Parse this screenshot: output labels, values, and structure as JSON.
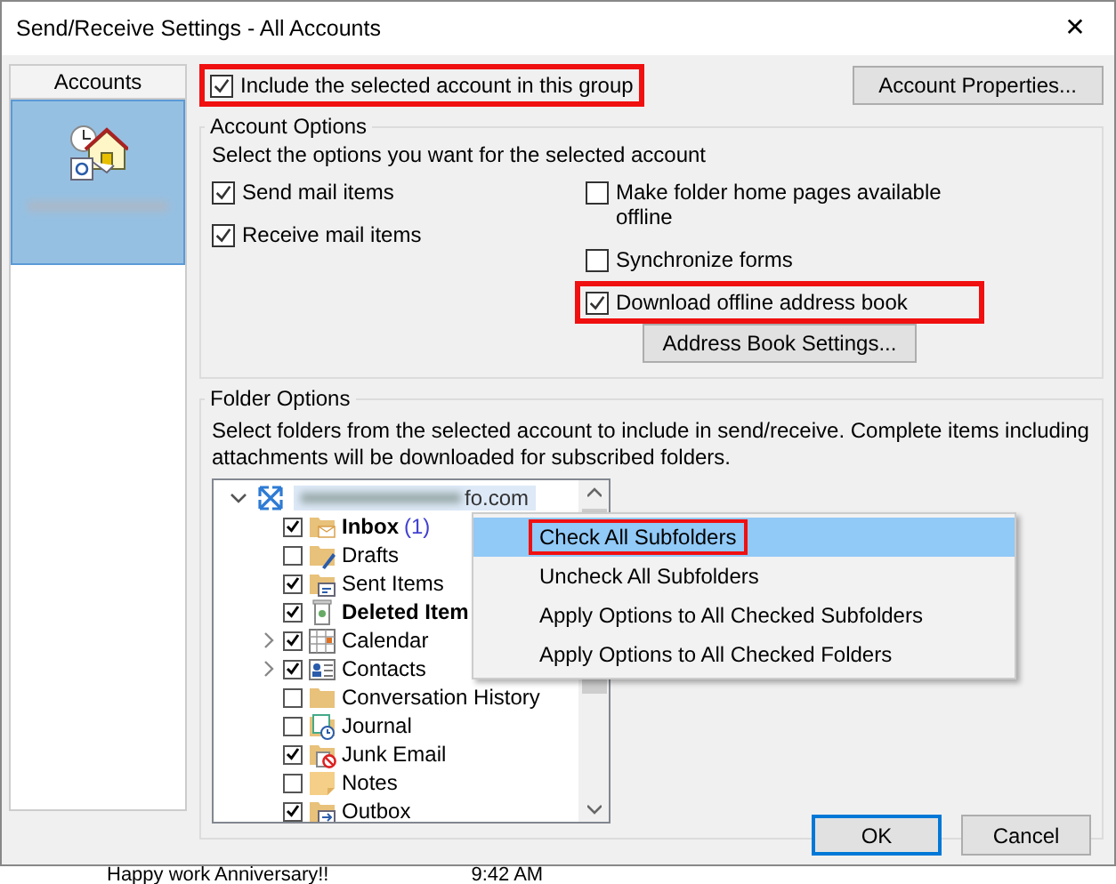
{
  "window": {
    "title": "Send/Receive Settings - All Accounts",
    "close": "✕"
  },
  "accounts": {
    "heading": "Accounts",
    "items": [
      {
        "selected": true
      }
    ]
  },
  "include": {
    "label": "Include the selected account in this group",
    "checked": true,
    "highlighted": true
  },
  "account_properties": "Account Properties...",
  "account_options": {
    "title": "Account Options",
    "intro": "Select the options you want for the selected account",
    "left": [
      {
        "label": "Send mail items",
        "checked": true,
        "highlighted": false
      },
      {
        "label": "Receive mail items",
        "checked": true,
        "highlighted": false
      }
    ],
    "right": [
      {
        "label": "Make folder home pages available offline",
        "checked": false,
        "highlighted": false
      },
      {
        "label": "Synchronize forms",
        "checked": false,
        "highlighted": false
      },
      {
        "label": "Download offline address book",
        "checked": true,
        "highlighted": true
      }
    ],
    "address_book_button": "Address Book Settings..."
  },
  "folder_options": {
    "title": "Folder Options",
    "intro": "Select folders from the selected account to include in send/receive. Complete items including attachments will be downloaded for subscribed folders.",
    "root": {
      "label": "fo.com",
      "expanded": true
    },
    "folders": [
      {
        "label": "Inbox",
        "count": "(1)",
        "bold": true,
        "checked": true,
        "kind": "mail"
      },
      {
        "label": "Drafts",
        "bold": false,
        "checked": false,
        "kind": "draft"
      },
      {
        "label": "Sent Items",
        "bold": false,
        "checked": true,
        "kind": "sent"
      },
      {
        "label": "Deleted Item",
        "bold": true,
        "checked": true,
        "kind": "trash"
      },
      {
        "label": "Calendar",
        "bold": false,
        "checked": true,
        "kind": "calendar",
        "expanded": false
      },
      {
        "label": "Contacts",
        "bold": false,
        "checked": true,
        "kind": "contacts",
        "expanded": false
      },
      {
        "label": "Conversation History",
        "bold": false,
        "checked": false,
        "kind": "folder"
      },
      {
        "label": "Journal",
        "bold": false,
        "checked": false,
        "kind": "journal"
      },
      {
        "label": "Junk Email",
        "bold": false,
        "checked": true,
        "kind": "junk"
      },
      {
        "label": "Notes",
        "bold": false,
        "checked": false,
        "kind": "note"
      },
      {
        "label": "Outbox",
        "bold": false,
        "checked": true,
        "kind": "outbox"
      }
    ]
  },
  "context_menu": [
    {
      "label": "Check All Subfolders",
      "selected": true,
      "highlighted": true
    },
    {
      "label": "Uncheck All Subfolders",
      "selected": false,
      "highlighted": false
    },
    {
      "label": "Apply Options to All Checked Subfolders",
      "selected": false,
      "highlighted": false
    },
    {
      "label": "Apply Options to All Checked Folders",
      "selected": false,
      "highlighted": false
    }
  ],
  "buttons": [
    {
      "label": "OK",
      "default": true
    },
    {
      "label": "Cancel",
      "default": false
    }
  ],
  "background": {
    "subject": "Happy work Anniversary!!",
    "time": "9:42 AM"
  }
}
